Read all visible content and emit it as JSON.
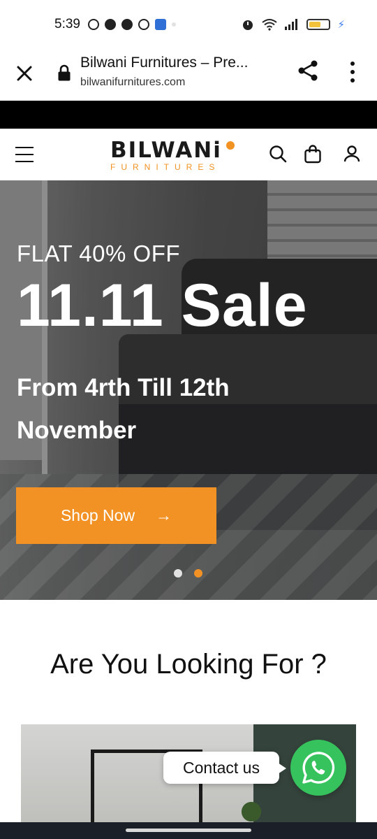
{
  "status_bar": {
    "time": "5:39"
  },
  "browser": {
    "page_title": "Bilwani Furnitures – Pre...",
    "url": "bilwanifurnitures.com"
  },
  "site_header": {
    "logo_main": "BILWANi",
    "logo_sub": "FURNITURES"
  },
  "hero": {
    "eyebrow": "FLAT 40% OFF",
    "title": "11.11 Sale",
    "subtitle": "From 4rth Till 12th November",
    "cta_label": "Shop Now",
    "cta_arrow": "→",
    "slides_total": 2,
    "active_slide": 2
  },
  "section": {
    "title": "Are You Looking For ?"
  },
  "contact": {
    "label": "Contact us"
  },
  "colors": {
    "accent": "#f39224",
    "whatsapp": "#36c35d"
  }
}
